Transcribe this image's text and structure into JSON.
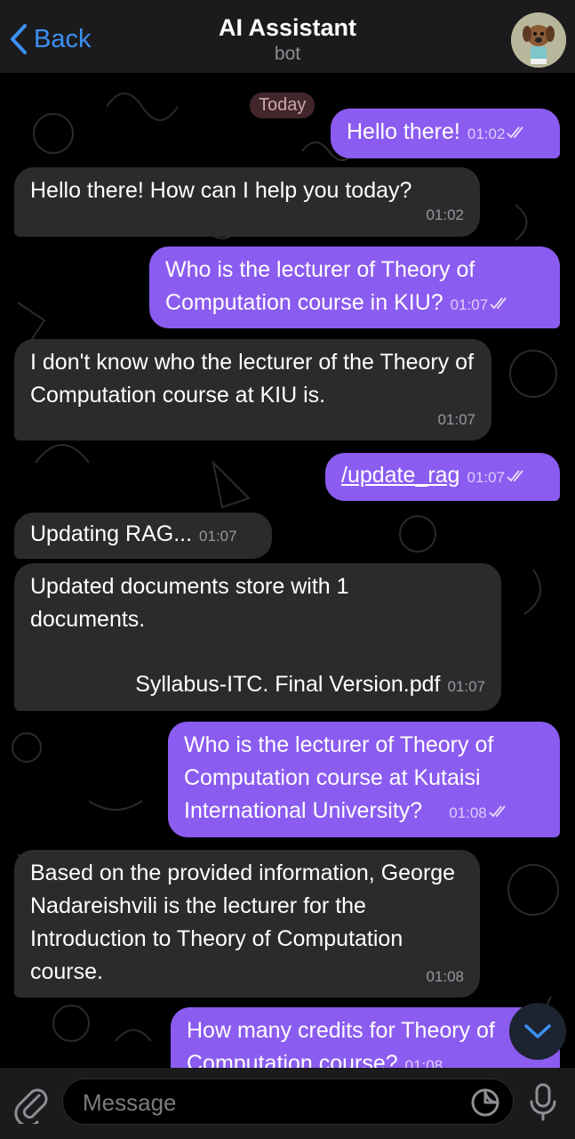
{
  "header": {
    "back_label": "Back",
    "title": "AI Assistant",
    "subtitle": "bot",
    "avatar_icon": "bot-avatar-icon"
  },
  "chat": {
    "date_label": "Today",
    "messages": [
      {
        "dir": "out",
        "text": "Hello there!",
        "time": "01:02",
        "status": "read"
      },
      {
        "dir": "in",
        "text": "Hello there!  How can I help you today?",
        "time": "01:02"
      },
      {
        "dir": "out",
        "text": "Who is the lecturer of Theory of Computation course in KIU?",
        "time": "01:07",
        "status": "read"
      },
      {
        "dir": "in",
        "text": "I don't know who the lecturer of the Theory of Computation course at KIU is.",
        "time": "01:07"
      },
      {
        "dir": "out",
        "text": "/update_rag",
        "time": "01:07",
        "status": "read",
        "is_command": true
      },
      {
        "dir": "in",
        "text": "Updating RAG...",
        "time": "01:07"
      },
      {
        "dir": "in",
        "text_line1": "Updated documents store with 1 documents.",
        "text_line2": "Syllabus-ITC. Final Version.pdf",
        "time": "01:07"
      },
      {
        "dir": "out",
        "text": "Who is the lecturer of Theory of Computation course at Kutaisi International University?",
        "time": "01:08",
        "status": "read"
      },
      {
        "dir": "in",
        "text": "Based on the provided information, George Nadareishvili is the lecturer for the Introduction to Theory of Computation course.",
        "time": "01:08"
      },
      {
        "dir": "out",
        "text": "How many credits for Theory of Computation course?",
        "time": "01:08",
        "status": "partial"
      }
    ]
  },
  "input": {
    "placeholder": "Message",
    "value": ""
  },
  "colors": {
    "outgoing_bubble": "#8b5cf0",
    "incoming_bubble": "#2d2a2e",
    "accent": "#3b91f3",
    "header_bg": "#1b1b1d"
  },
  "icons": {
    "back": "chevron-left-icon",
    "read": "double-check-icon",
    "scroll_down": "chevron-down-icon",
    "attach": "paperclip-icon",
    "sticker": "sticker-icon",
    "mic": "microphone-icon"
  }
}
